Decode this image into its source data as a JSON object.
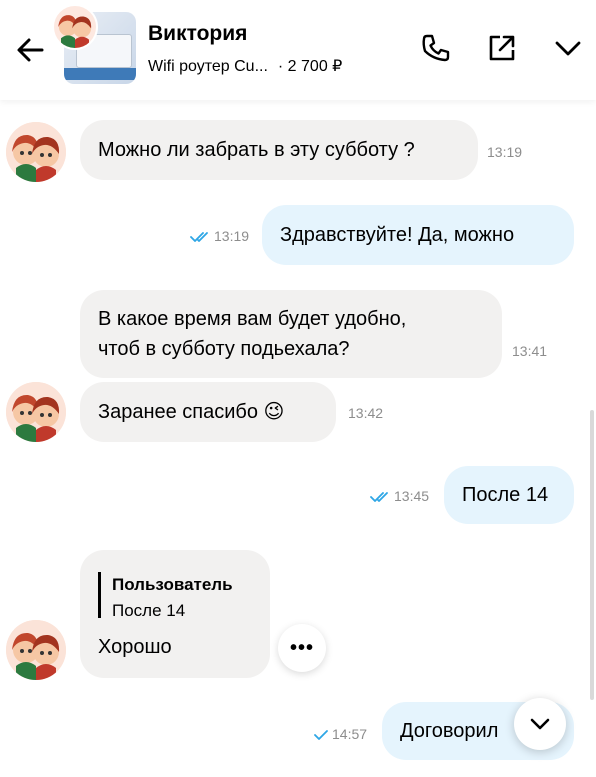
{
  "header": {
    "contact_name": "Виктория",
    "item_title": "Wifi роутер Cu...",
    "item_price": "· 2 700 ₽"
  },
  "messages": [
    {
      "direction": "in",
      "text": "Можно ли забрать в эту субботу ?",
      "time": "13:19"
    },
    {
      "direction": "out",
      "text": "Здравствуйте! Да, можно",
      "time": "13:19",
      "status": "read"
    },
    {
      "direction": "in",
      "text_line1": "В какое время вам будет удобно,",
      "text_line2": "чтоб в субботу подьехала?",
      "time": "13:41"
    },
    {
      "direction": "in",
      "text": "Заранее спасибо 😉",
      "time": "13:42"
    },
    {
      "direction": "out",
      "text": "После 14",
      "time": "13:45",
      "status": "read"
    },
    {
      "direction": "in",
      "quote_author": "Пользователь",
      "quote_text": "После 14",
      "text": "Хорошо"
    },
    {
      "direction": "out",
      "text": "Договорил",
      "time": "14:57",
      "status": "sent"
    }
  ],
  "colors": {
    "incoming_bubble": "#f2f1f0",
    "outgoing_bubble": "#e5f4fd",
    "read_check": "#2ea6e6",
    "time_text": "#8d8d8d"
  }
}
